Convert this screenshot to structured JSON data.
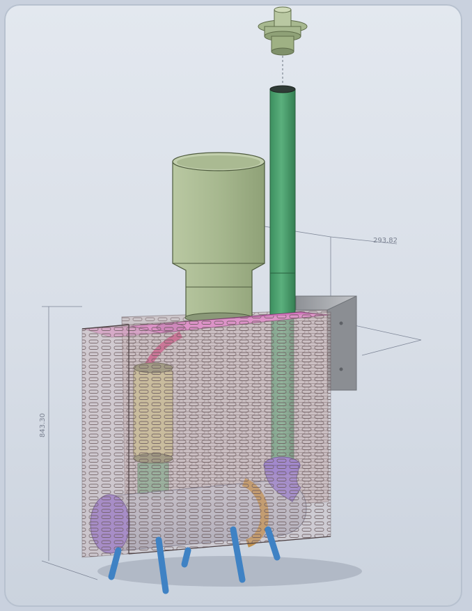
{
  "dimensions": {
    "depth": "293.82",
    "height": "843.30"
  },
  "colors": {
    "background": "#d8dee7",
    "mesh_cage": "#b9a4a6",
    "top_plate": "#e77fd1",
    "funnel": "#a7b88f",
    "pipe": "#4fa070",
    "filter_cartridge": "#c9c08a",
    "purple_caps": "#8b6fd6",
    "legs": "#3f82c4",
    "bronze_ring": "#c08a3c",
    "wall_bracket": "#a9abaf"
  }
}
